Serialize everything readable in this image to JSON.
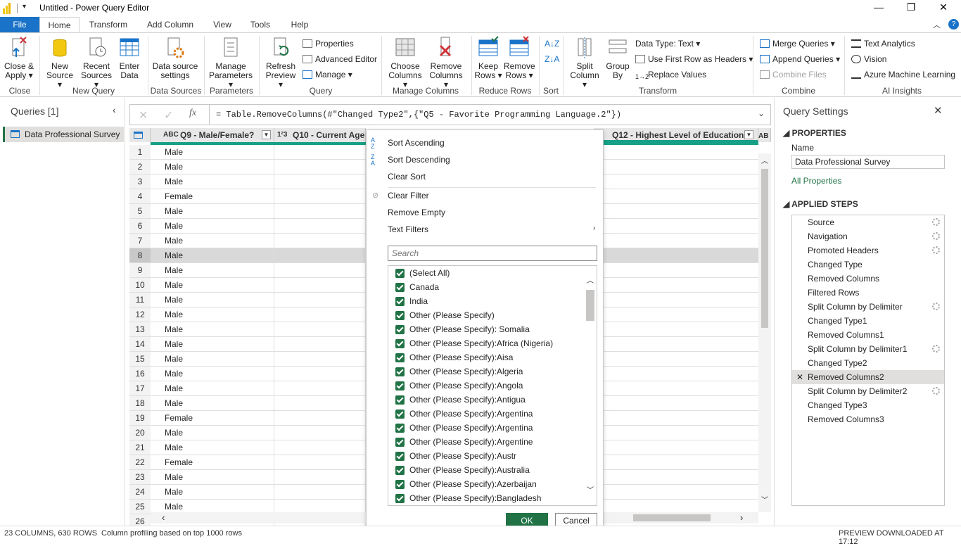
{
  "window": {
    "title": "Untitled - Power Query Editor"
  },
  "tabs": [
    "File",
    "Home",
    "Transform",
    "Add Column",
    "View",
    "Tools",
    "Help"
  ],
  "ribbon": {
    "close_apply": "Close &",
    "close_apply2": "Apply",
    "new_source": "New",
    "new_source2": "Source",
    "recent_sources": "Recent",
    "recent_sources2": "Sources",
    "enter_data": "Enter",
    "enter_data2": "Data",
    "ds_settings": "Data source",
    "ds_settings2": "settings",
    "manage_params": "Manage",
    "manage_params2": "Parameters",
    "refresh": "Refresh",
    "refresh2": "Preview",
    "properties": "Properties",
    "advanced_editor": "Advanced Editor",
    "manage": "Manage",
    "choose_cols": "Choose",
    "choose_cols2": "Columns",
    "remove_cols": "Remove",
    "remove_cols2": "Columns",
    "keep_rows": "Keep",
    "keep_rows2": "Rows",
    "remove_rows": "Remove",
    "remove_rows2": "Rows",
    "split_col": "Split",
    "split_col2": "Column",
    "group_by": "Group",
    "group_by2": "By",
    "data_type": "Data Type: Text",
    "first_row": "Use First Row as Headers",
    "replace_values": "Replace Values",
    "merge_queries": "Merge Queries",
    "append_queries": "Append Queries",
    "combine_files": "Combine Files",
    "text_analytics": "Text Analytics",
    "vision": "Vision",
    "azure_ml": "Azure Machine Learning",
    "groups": [
      "Close",
      "New Query",
      "Data Sources",
      "Parameters",
      "Query",
      "Manage Columns",
      "Reduce Rows",
      "Sort",
      "Transform",
      "Combine",
      "AI Insights"
    ]
  },
  "queries": {
    "title": "Queries [1]",
    "item": "Data Professional Survey"
  },
  "formula": "= Table.RemoveColumns(#\"Changed Type2\",{\"Q5 - Favorite Programming Language.2\"})",
  "grid": {
    "col1": "Q9 - Male/Female?",
    "col2": "Q10 - Current Age",
    "col4": "Q12 - Highest Level of Education",
    "rows": [
      "Male",
      "Male",
      "Male",
      "Female",
      "Male",
      "Male",
      "Male",
      "Male",
      "Male",
      "Male",
      "Male",
      "Male",
      "Male",
      "Male",
      "Male",
      "Male",
      "Male",
      "Male",
      "Female",
      "Male",
      "Male",
      "Female",
      "Male",
      "Male",
      "Male",
      ""
    ],
    "row_numbers": [
      "1",
      "2",
      "3",
      "4",
      "5",
      "6",
      "7",
      "8",
      "9",
      "10",
      "11",
      "12",
      "13",
      "14",
      "15",
      "16",
      "17",
      "18",
      "19",
      "20",
      "21",
      "22",
      "23",
      "24",
      "25",
      "26"
    ]
  },
  "popup": {
    "sort_asc": "Sort Ascending",
    "sort_desc": "Sort Descending",
    "clear_sort": "Clear Sort",
    "clear_filter": "Clear Filter",
    "remove_empty": "Remove Empty",
    "text_filters": "Text Filters",
    "search_placeholder": "Search",
    "items": [
      "(Select All)",
      "Canada",
      "India",
      "Other (Please Specify)",
      "Other (Please Specify): Somalia",
      "Other (Please Specify):Africa (Nigeria)",
      "Other (Please Specify):Aisa",
      "Other (Please Specify):Algeria",
      "Other (Please Specify):Angola",
      "Other (Please Specify):Antigua",
      "Other (Please Specify):Argentina",
      "Other (Please Specify):Argentina",
      "Other (Please Specify):Argentine",
      "Other (Please Specify):Austr",
      "Other (Please Specify):Australia",
      "Other (Please Specify):Azerbaijan",
      "Other (Please Specify):Bangladesh"
    ],
    "ok": "OK",
    "cancel": "Cancel"
  },
  "settings": {
    "title": "Query Settings",
    "properties": "PROPERTIES",
    "name_label": "Name",
    "name_value": "Data Professional Survey",
    "all_properties": "All Properties",
    "applied_steps": "APPLIED STEPS",
    "steps": [
      "Source",
      "Navigation",
      "Promoted Headers",
      "Changed Type",
      "Removed Columns",
      "Filtered Rows",
      "Split Column by Delimiter",
      "Changed Type1",
      "Removed Columns1",
      "Split Column by Delimiter1",
      "Changed Type2",
      "Removed Columns2",
      "Split Column by Delimiter2",
      "Changed Type3",
      "Removed Columns3"
    ]
  },
  "status": {
    "left": "23 COLUMNS, 630 ROWS",
    "profiling": "Column profiling based on top 1000 rows",
    "right": "PREVIEW DOWNLOADED AT 17:12"
  },
  "colors": {
    "accent": "#217346",
    "file_tab": "#1a73c8",
    "selected_step": "#e1dfdd"
  }
}
